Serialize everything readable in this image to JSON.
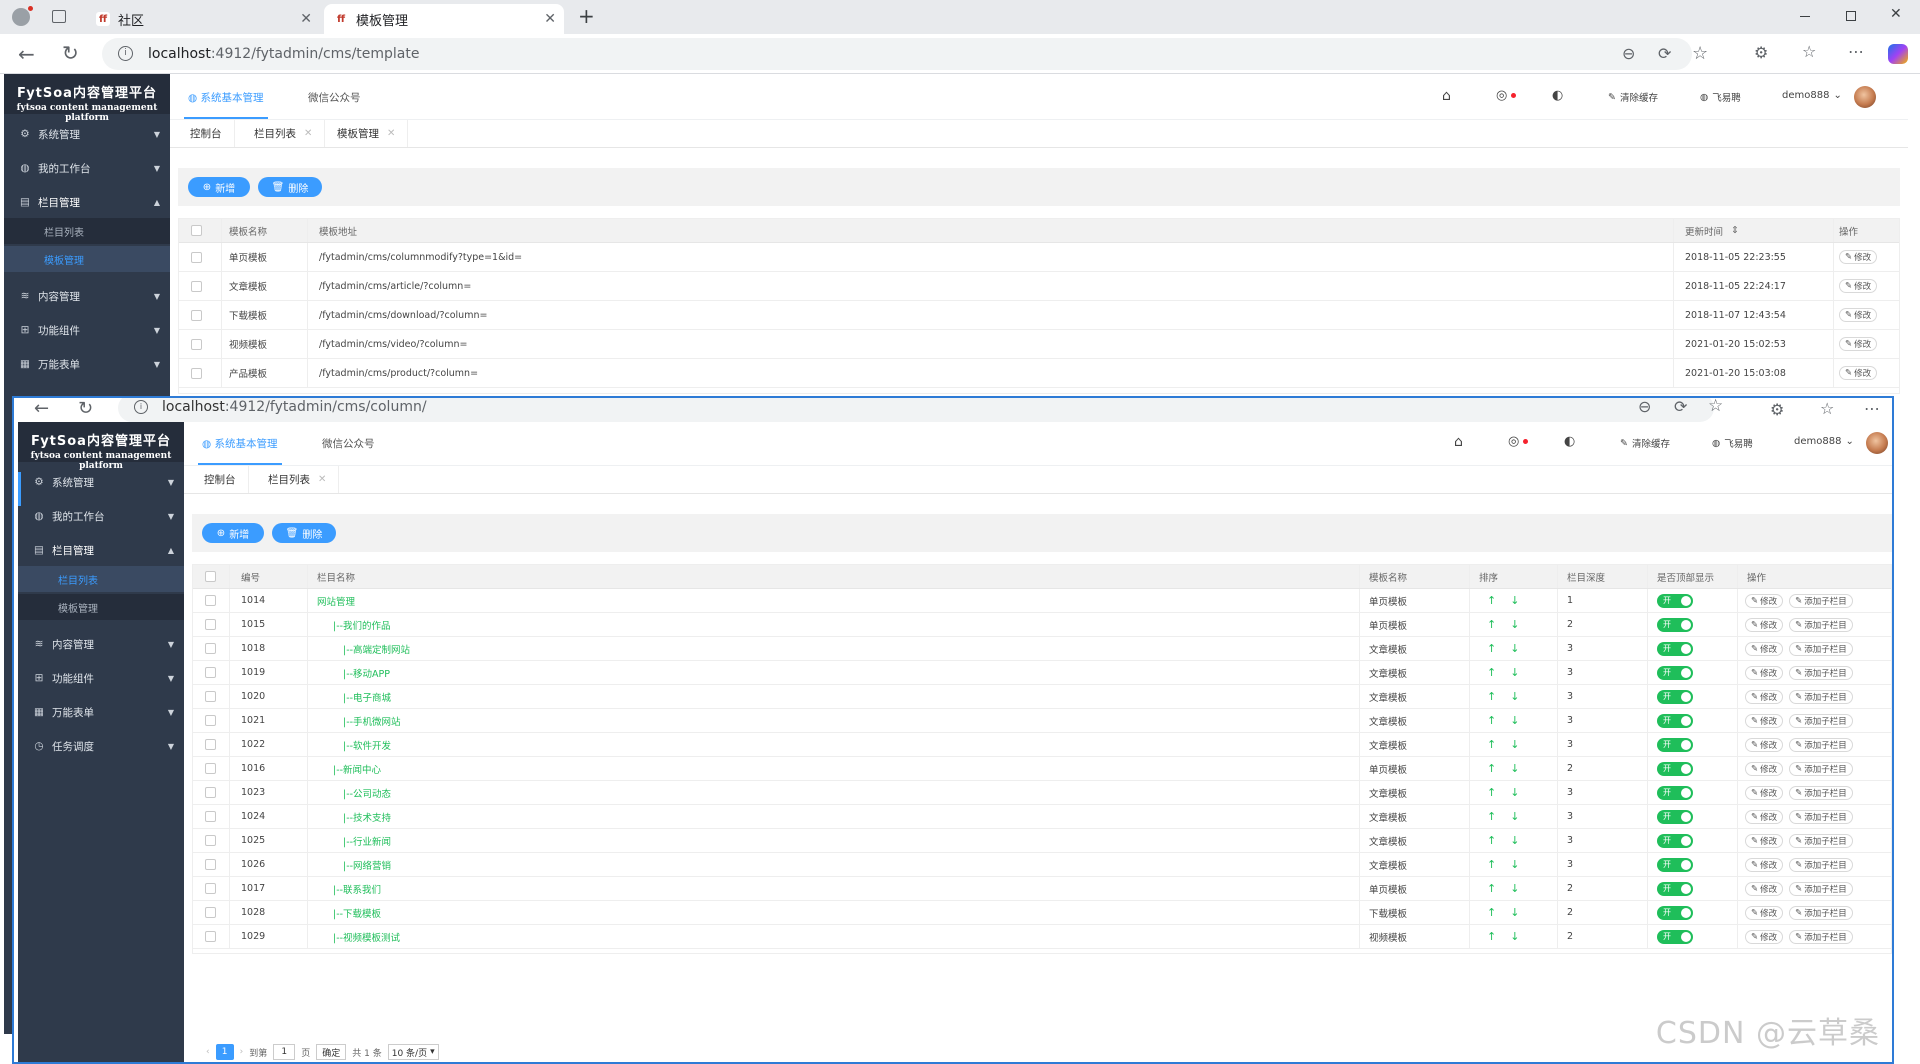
{
  "browser": {
    "tabs": [
      {
        "label": "社区"
      },
      {
        "label": "模板管理"
      }
    ],
    "new_tab": "+",
    "url_host": "localhost",
    "url_rest": ":4912/fytadmin/cms/template"
  },
  "app": {
    "logo_title": "FytSoa内容管理平台",
    "logo_subtitle": "fytsoa content management platform",
    "header_tabs": [
      "系统基本管理",
      "微信公众号"
    ],
    "clear_cache": "清除缓存",
    "feiyi": "飞易聘",
    "username": "demo888",
    "add_label": "新增",
    "delete_label": "删除",
    "edit_label": "修改",
    "add_child_label": "添加子栏目",
    "switch_on": "开",
    "accent": "#3b9cff",
    "green": "#1fbe5a"
  },
  "back_window": {
    "sidebar": {
      "items": [
        "系统管理",
        "我的工作台",
        "栏目管理",
        "内容管理",
        "功能组件",
        "万能表单",
        "任务调度"
      ],
      "sub_items": [
        "栏目列表",
        "模板管理"
      ],
      "active_sub": "模板管理"
    },
    "page_tabs": [
      "控制台",
      "栏目列表",
      "模板管理"
    ],
    "table": {
      "headers": [
        "模板名称",
        "模板地址",
        "更新时间",
        "操作"
      ],
      "rows": [
        {
          "name": "单页模板",
          "path": "/fytadmin/cms/columnmodify?type=1&id=",
          "time": "2018-11-05 22:23:55"
        },
        {
          "name": "文章模板",
          "path": "/fytadmin/cms/article/?column=",
          "time": "2018-11-05 22:24:17"
        },
        {
          "name": "下载模板",
          "path": "/fytadmin/cms/download/?column=",
          "time": "2018-11-07 12:43:54"
        },
        {
          "name": "视频模板",
          "path": "/fytadmin/cms/video/?column=",
          "time": "2021-01-20 15:02:53"
        },
        {
          "name": "产品模板",
          "path": "/fytadmin/cms/product/?column=",
          "time": "2021-01-20 15:03:08"
        }
      ]
    }
  },
  "front_window": {
    "url_host": "localhost",
    "url_rest": ":4912/fytadmin/cms/column/",
    "sidebar": {
      "items": [
        "系统管理",
        "我的工作台",
        "栏目管理",
        "内容管理",
        "功能组件",
        "万能表单",
        "任务调度"
      ],
      "sub_items": [
        "栏目列表",
        "模板管理"
      ],
      "active_sub": "栏目列表"
    },
    "page_tabs": [
      "控制台",
      "栏目列表"
    ],
    "table": {
      "headers": [
        "编号",
        "栏目名称",
        "模板名称",
        "排序",
        "栏目深度",
        "是否顶部显示",
        "操作"
      ],
      "rows": [
        {
          "id": "1014",
          "name": "网站管理",
          "template": "单页模板",
          "depth": "1"
        },
        {
          "id": "1015",
          "name": "|--我们的作品",
          "template": "单页模板",
          "depth": "2"
        },
        {
          "id": "1018",
          "name": "|--高端定制网站",
          "template": "文章模板",
          "depth": "3"
        },
        {
          "id": "1019",
          "name": "|--移动APP",
          "template": "文章模板",
          "depth": "3"
        },
        {
          "id": "1020",
          "name": "|--电子商城",
          "template": "文章模板",
          "depth": "3"
        },
        {
          "id": "1021",
          "name": "|--手机微网站",
          "template": "文章模板",
          "depth": "3"
        },
        {
          "id": "1022",
          "name": "|--软件开发",
          "template": "文章模板",
          "depth": "3"
        },
        {
          "id": "1016",
          "name": "|--新闻中心",
          "template": "单页模板",
          "depth": "2"
        },
        {
          "id": "1023",
          "name": "|--公司动态",
          "template": "文章模板",
          "depth": "3"
        },
        {
          "id": "1024",
          "name": "|--技术支持",
          "template": "文章模板",
          "depth": "3"
        },
        {
          "id": "1025",
          "name": "|--行业新闻",
          "template": "文章模板",
          "depth": "3"
        },
        {
          "id": "1026",
          "name": "|--网络营销",
          "template": "文章模板",
          "depth": "3"
        },
        {
          "id": "1017",
          "name": "|--联系我们",
          "template": "单页模板",
          "depth": "2"
        },
        {
          "id": "1028",
          "name": "|--下载模板",
          "template": "下载模板",
          "depth": "2"
        },
        {
          "id": "1029",
          "name": "|--视频模板测试",
          "template": "视频模板",
          "depth": "2"
        }
      ]
    },
    "pager": {
      "current": "1",
      "goto_label": "到第",
      "page_value": "1",
      "page_unit": "页",
      "confirm": "确定",
      "total": "共 1 条",
      "per_page": "10 条/页"
    }
  },
  "watermark": "CSDN @云草桑"
}
